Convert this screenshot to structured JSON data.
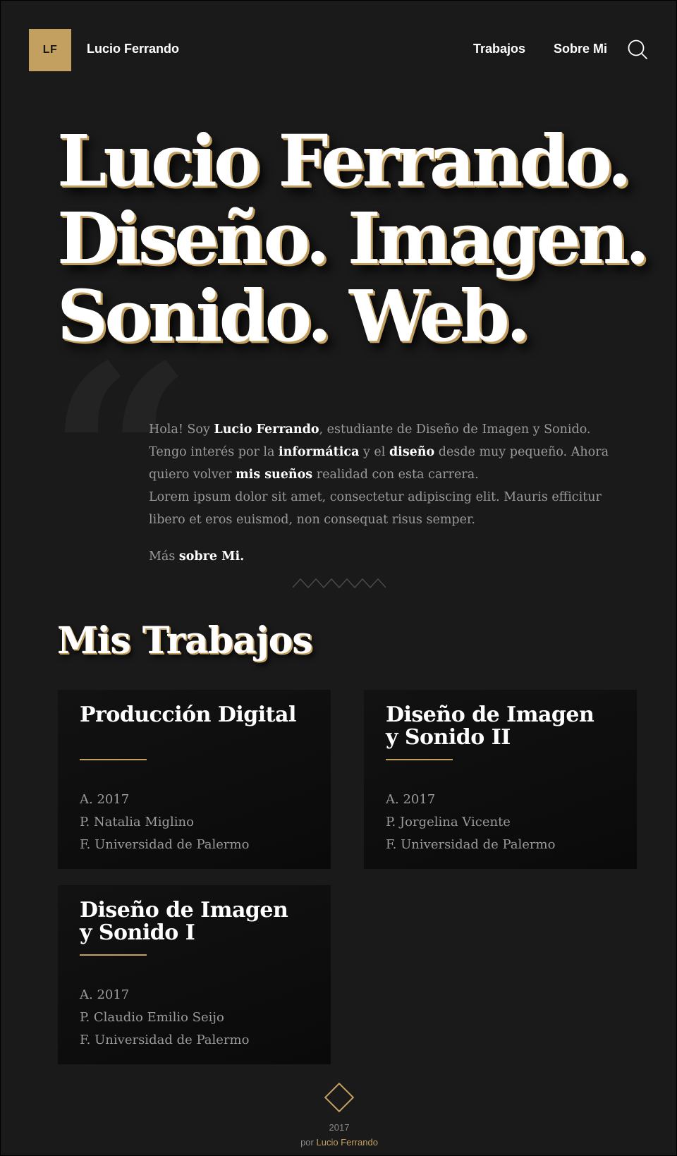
{
  "header": {
    "logo_text": "LF",
    "site_name": "Lucio Ferrando",
    "nav": [
      {
        "label": "Trabajos"
      },
      {
        "label": "Sobre Mi"
      }
    ],
    "search_icon": "search-icon"
  },
  "hero": {
    "lines": [
      "Lucio Ferrando.",
      "Diseño. Imagen.",
      "Sonido. Web."
    ]
  },
  "intro": {
    "quote_icon": "quote-icon",
    "t1": "Hola! Soy ",
    "b1": "Lucio Ferrando",
    "t2": ", estudiante de Diseño de Imagen y Sonido. Tengo interés por la ",
    "b2": "informática",
    "t3": " y el ",
    "b3": "diseño",
    "t4": " desde muy pequeño. Ahora quiero volver ",
    "b4": "mis sueños",
    "t5": " realidad con esta carrera.",
    "lorem": "Lorem ipsum dolor sit amet, consectetur adipiscing elit. Mauris efficitur libero et eros euismod, non consequat risus semper.",
    "more_prefix": "Más ",
    "more_link": "sobre Mi."
  },
  "works": {
    "title": "Mis Trabajos",
    "cards": [
      {
        "title": "Producción Digital",
        "year": "A. 2017",
        "professor": "P. Natalia Miglino",
        "faculty": "F. Universidad de Palermo"
      },
      {
        "title_line1": "Diseño de Imagen",
        "title_line2": "y Sonido II",
        "year": "A. 2017",
        "professor": "P. Jorgelina Vicente",
        "faculty": "F. Universidad de Palermo"
      },
      {
        "title_line1": "Diseño de Imagen",
        "title_line2": "y Sonido I",
        "year": "A. 2017",
        "professor": "P. Claudio Emilio Seijo",
        "faculty": "F. Universidad de Palermo"
      }
    ]
  },
  "footer": {
    "year": "2017",
    "by": "por",
    "author": "Lucio Ferrando"
  },
  "colors": {
    "background": "#1a1a1b",
    "accent": "#c4a060",
    "card": "#0e0e0f",
    "muted_text": "#9a9a9a"
  }
}
